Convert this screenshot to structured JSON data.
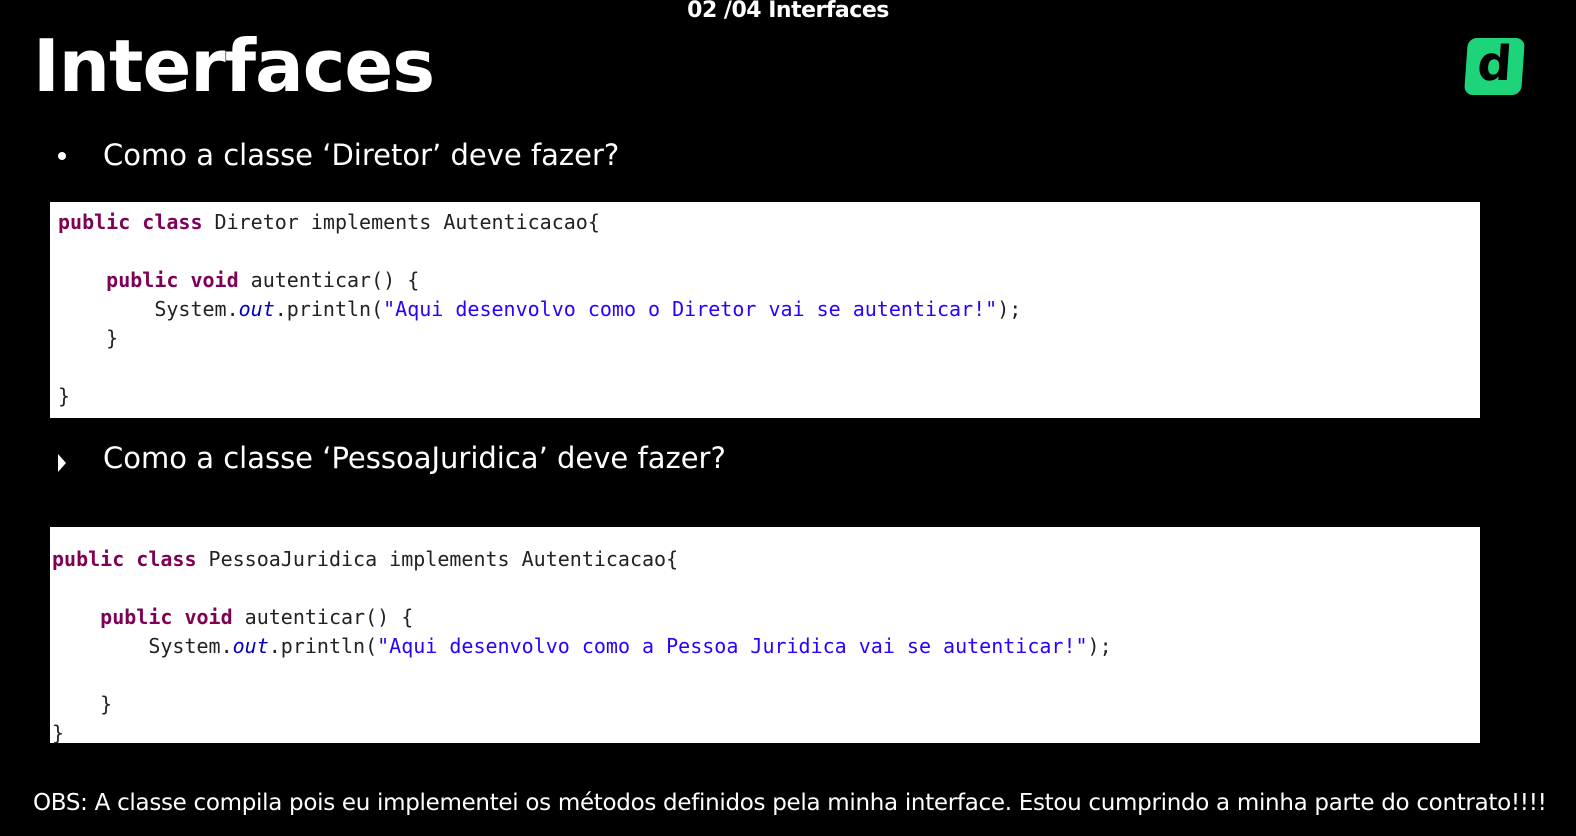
{
  "top_caption": "02 /04 Interfaces",
  "title": "Interfaces",
  "logo": {
    "letter": "d",
    "color": "#1ed47a"
  },
  "question_1": "Como a classe ‘Diretor’ deve fazer?",
  "question_2": "Como a classe ‘PessoaJuridica’ deve fazer?",
  "code_1": {
    "line1_kw": "public class",
    "line1_rest": " Diretor implements Autenticacao{",
    "line2_kw": "public void",
    "line2_rest": " autenticar() {",
    "line3_pre": "System.",
    "line3_field": "out",
    "line3_mid": ".println(",
    "line3_str": "\"Aqui desenvolvo como o Diretor vai se autenticar!\"",
    "line3_end": ");",
    "line4": "}",
    "line5": "}"
  },
  "code_2": {
    "line1_kw": "public class",
    "line1_rest": " PessoaJuridica implements Autenticacao{",
    "line2_kw": "public void",
    "line2_rest": " autenticar() {",
    "line3_pre": "System.",
    "line3_field": "out",
    "line3_mid": ".println(",
    "line3_str": "\"Aqui desenvolvo como a Pessoa Juridica vai se autenticar!\"",
    "line3_end": ");",
    "line4": "}",
    "line5": "}"
  },
  "obs": "OBS: A classe compila pois eu implementei os métodos definidos pela minha interface. Estou cumprindo a minha parte do contrato!!!!"
}
